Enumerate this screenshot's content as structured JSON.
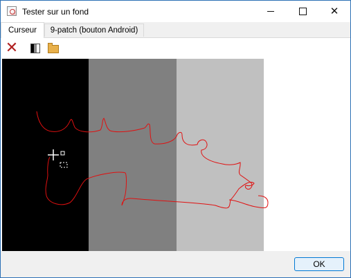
{
  "window": {
    "title": "Tester sur un fond",
    "icon": "app-preview-icon",
    "controls": {
      "minimize_icon": "minimize-icon",
      "maximize_icon": "maximize-icon",
      "close_icon": "close-icon"
    }
  },
  "tabs": [
    {
      "label": "Curseur",
      "active": true
    },
    {
      "label": "9-patch (bouton Android)",
      "active": false
    }
  ],
  "toolbar": {
    "items": [
      {
        "icon": "clear-drawing-icon",
        "color": "#b02020"
      },
      {
        "icon": "background-shades-icon"
      },
      {
        "icon": "open-folder-icon",
        "color": "#e8b04a"
      }
    ]
  },
  "canvas": {
    "backgrounds": [
      "#000000",
      "#808080",
      "#c0c0c0",
      "#ffffff"
    ],
    "stroke_color": "#e01010",
    "cursor_icon": "crosshair-cursor-icon"
  },
  "footer": {
    "ok_label": "OK"
  }
}
